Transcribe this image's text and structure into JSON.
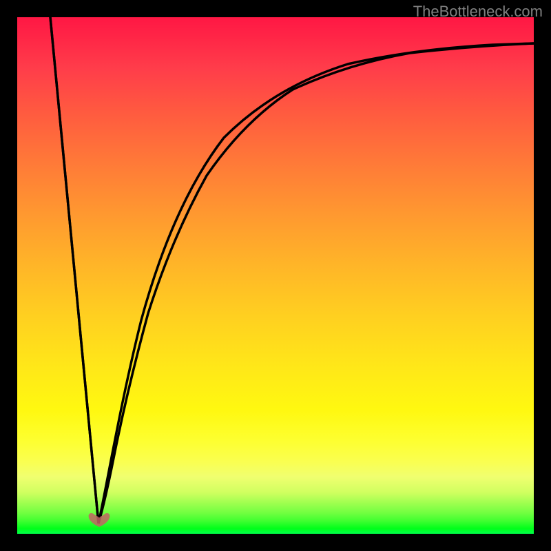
{
  "watermark": "TheBottleneck.com",
  "chart_data": {
    "type": "line",
    "title": "",
    "xlabel": "",
    "ylabel": "",
    "xlim": [
      0,
      100
    ],
    "ylim": [
      0,
      100
    ],
    "background_gradient": {
      "top_color": "#ff1744",
      "bottom_color": "#00ff4a",
      "description": "red-orange-yellow-green vertical gradient"
    },
    "curve": {
      "description": "V-shaped curve with sharp minimum near x=16, left branch steep linear from top, right branch rises asymptotically",
      "minimum_x": 16,
      "minimum_y": 2,
      "left_start": {
        "x": 6,
        "y": 100
      },
      "right_end": {
        "x": 100,
        "y": 94
      }
    },
    "marker": {
      "type": "heart",
      "x": 16,
      "y": 2,
      "color": "#c96060"
    }
  }
}
